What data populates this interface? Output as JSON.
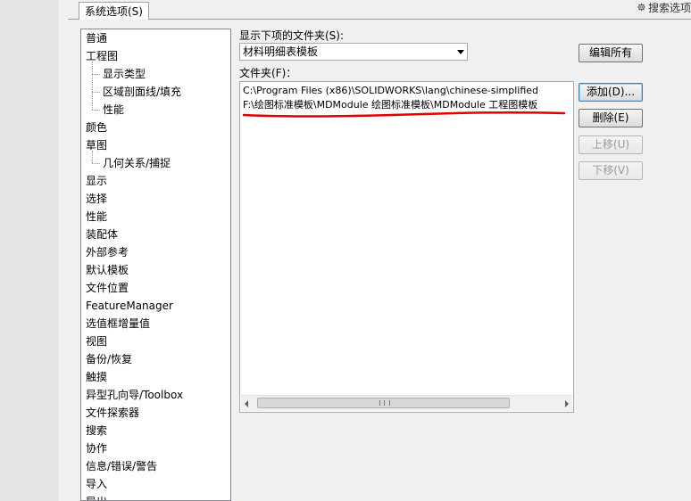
{
  "window": {
    "tab_label": "系统选项(S)",
    "search_label": "搜索选项"
  },
  "tree": {
    "items": [
      {
        "label": "普通",
        "level": 0
      },
      {
        "label": "工程图",
        "level": 0
      },
      {
        "label": "显示类型",
        "level": 1
      },
      {
        "label": "区域剖面线/填充",
        "level": 1
      },
      {
        "label": "性能",
        "level": 1
      },
      {
        "label": "颜色",
        "level": 0
      },
      {
        "label": "草图",
        "level": 0
      },
      {
        "label": "几何关系/捕捉",
        "level": 1
      },
      {
        "label": "显示",
        "level": 0
      },
      {
        "label": "选择",
        "level": 0
      },
      {
        "label": "性能",
        "level": 0
      },
      {
        "label": "装配体",
        "level": 0
      },
      {
        "label": "外部参考",
        "level": 0
      },
      {
        "label": "默认模板",
        "level": 0
      },
      {
        "label": "文件位置",
        "level": 0
      },
      {
        "label": "FeatureManager",
        "level": 0
      },
      {
        "label": "选值框增量值",
        "level": 0
      },
      {
        "label": "视图",
        "level": 0
      },
      {
        "label": "备份/恢复",
        "level": 0
      },
      {
        "label": "触摸",
        "level": 0
      },
      {
        "label": "异型孔向导/Toolbox",
        "level": 0
      },
      {
        "label": "文件探索器",
        "level": 0
      },
      {
        "label": "搜索",
        "level": 0
      },
      {
        "label": "协作",
        "level": 0
      },
      {
        "label": "信息/错误/警告",
        "level": 0
      },
      {
        "label": "导入",
        "level": 0
      },
      {
        "label": "导出",
        "level": 0
      }
    ]
  },
  "show_folders": {
    "label": "显示下项的文件夹(S):",
    "selected": "材料明细表模板"
  },
  "folders": {
    "label": "文件夹(F)：",
    "entries": [
      "C:\\Program Files (x86)\\SOLIDWORKS\\lang\\chinese-simplified",
      "F:\\绘图标准模板\\MDModule 绘图标准模板\\MDModule 工程图模板"
    ]
  },
  "buttons": {
    "edit_all": "编辑所有",
    "add": "添加(D)...",
    "delete": "删除(E)",
    "move_up": "上移(U)",
    "move_down": "下移(V)"
  },
  "colors": {
    "annotation_red": "#e00000",
    "accent_blue": "#3c7fb1"
  }
}
